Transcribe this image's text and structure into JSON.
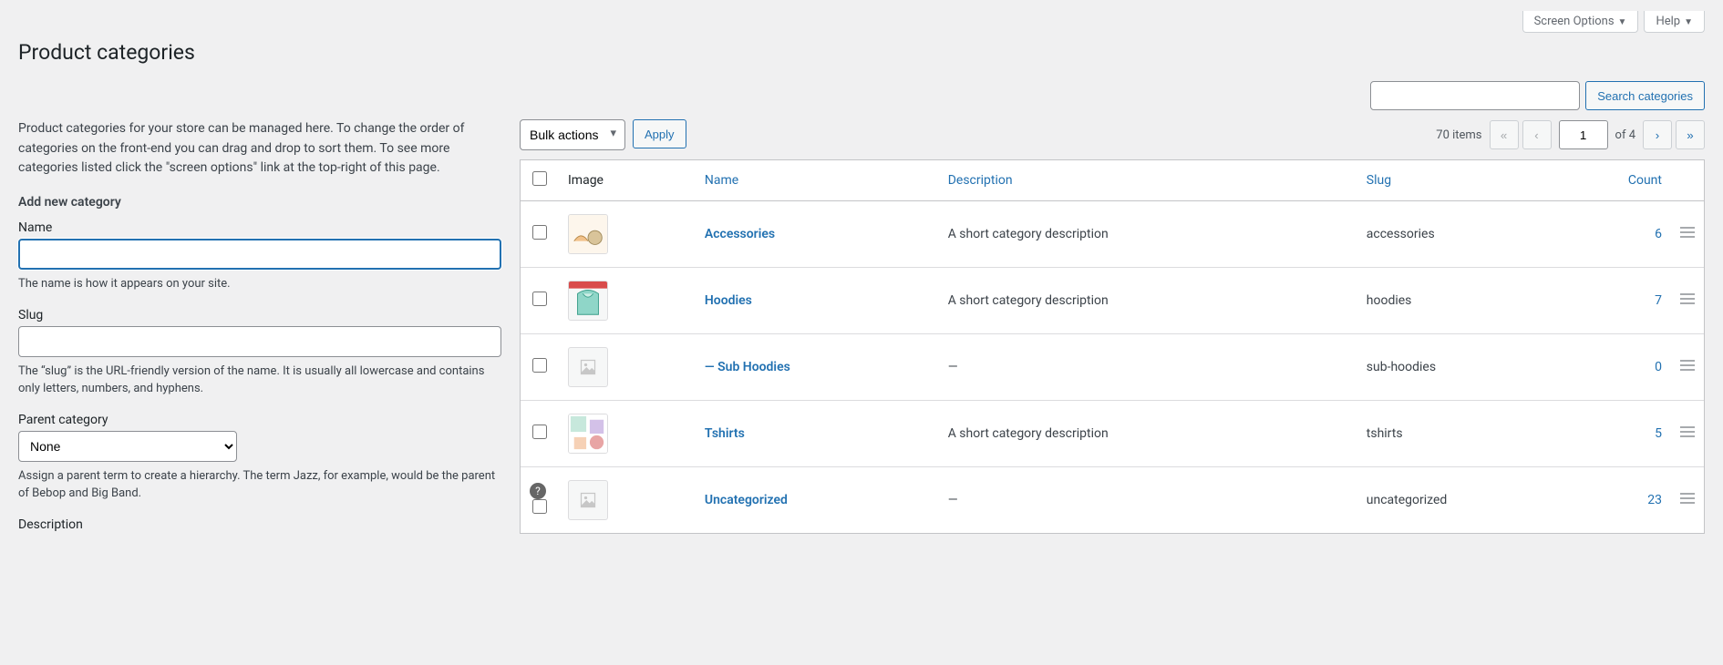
{
  "screen_meta": {
    "options": "Screen Options",
    "help": "Help"
  },
  "page_title": "Product categories",
  "search": {
    "placeholder": "",
    "button": "Search categories"
  },
  "intro": "Product categories for your store can be managed here. To change the order of categories on the front-end you can drag and drop to sort them. To see more categories listed click the \"screen options\" link at the top-right of this page.",
  "form": {
    "heading": "Add new category",
    "name_label": "Name",
    "name_help": "The name is how it appears on your site.",
    "slug_label": "Slug",
    "slug_help": "The “slug” is the URL-friendly version of the name. It is usually all lowercase and contains only letters, numbers, and hyphens.",
    "parent_label": "Parent category",
    "parent_value": "None",
    "parent_help": "Assign a parent term to create a hierarchy. The term Jazz, for example, would be the parent of Bebop and Big Band.",
    "description_label": "Description"
  },
  "bulk": {
    "label": "Bulk actions",
    "apply": "Apply"
  },
  "pagination": {
    "total": "70 items",
    "current": "1",
    "of": "of 4"
  },
  "columns": {
    "image": "Image",
    "name": "Name",
    "description": "Description",
    "slug": "Slug",
    "count": "Count"
  },
  "rows": [
    {
      "name": "Accessories",
      "desc": "A short category description",
      "slug": "accessories",
      "count": "6",
      "thumb": "accessories",
      "help": false
    },
    {
      "name": "Hoodies",
      "desc": "A short category description",
      "slug": "hoodies",
      "count": "7",
      "thumb": "hoodies",
      "help": false
    },
    {
      "name": "— Sub Hoodies",
      "desc": "—",
      "slug": "sub-hoodies",
      "count": "0",
      "thumb": "placeholder",
      "help": false
    },
    {
      "name": "Tshirts",
      "desc": "A short category description",
      "slug": "tshirts",
      "count": "5",
      "thumb": "tshirts",
      "help": false
    },
    {
      "name": "Uncategorized",
      "desc": "—",
      "slug": "uncategorized",
      "count": "23",
      "thumb": "placeholder",
      "help": true
    }
  ]
}
